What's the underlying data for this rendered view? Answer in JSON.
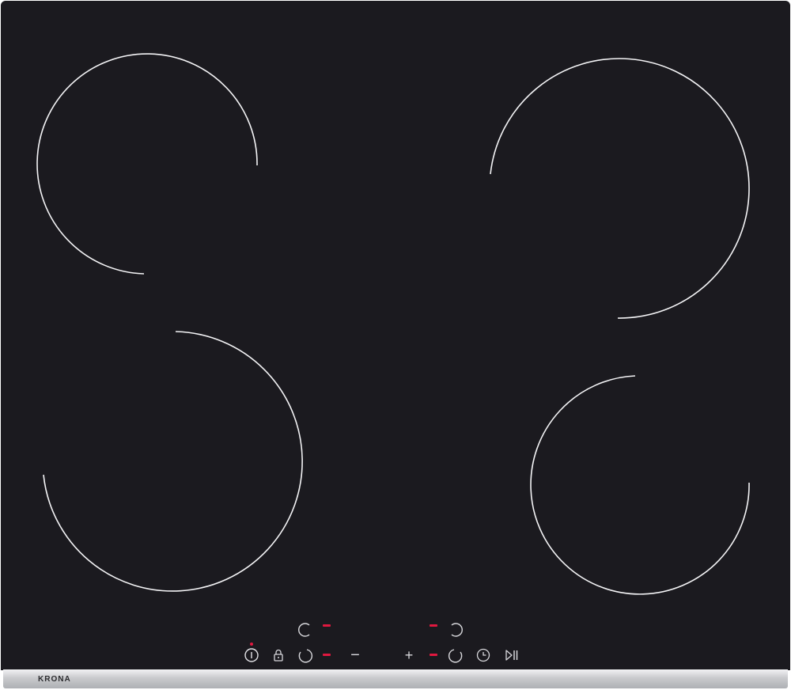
{
  "brand": {
    "name": "KRONA"
  },
  "colors": {
    "glass": "#1b1a1f",
    "zone_ring": "#ffffff",
    "indicator": "#e0183f",
    "trim": "#c9cacd"
  },
  "zones": [
    {
      "name": "rear-left",
      "state": "off"
    },
    {
      "name": "rear-right",
      "state": "off"
    },
    {
      "name": "front-left",
      "state": "off"
    },
    {
      "name": "front-right",
      "state": "off"
    }
  ],
  "controls": {
    "power": {
      "icon": "power-icon"
    },
    "lock": {
      "icon": "lock-icon"
    },
    "minus": {
      "label": "−"
    },
    "plus": {
      "label": "+"
    },
    "timer": {
      "icon": "clock-icon"
    },
    "pause": {
      "icon": "play-pause-icon"
    },
    "zone_selectors": [
      "rear-left",
      "front-left",
      "rear-right",
      "front-right"
    ],
    "displays": [
      "–",
      "–",
      "–",
      "–"
    ]
  }
}
